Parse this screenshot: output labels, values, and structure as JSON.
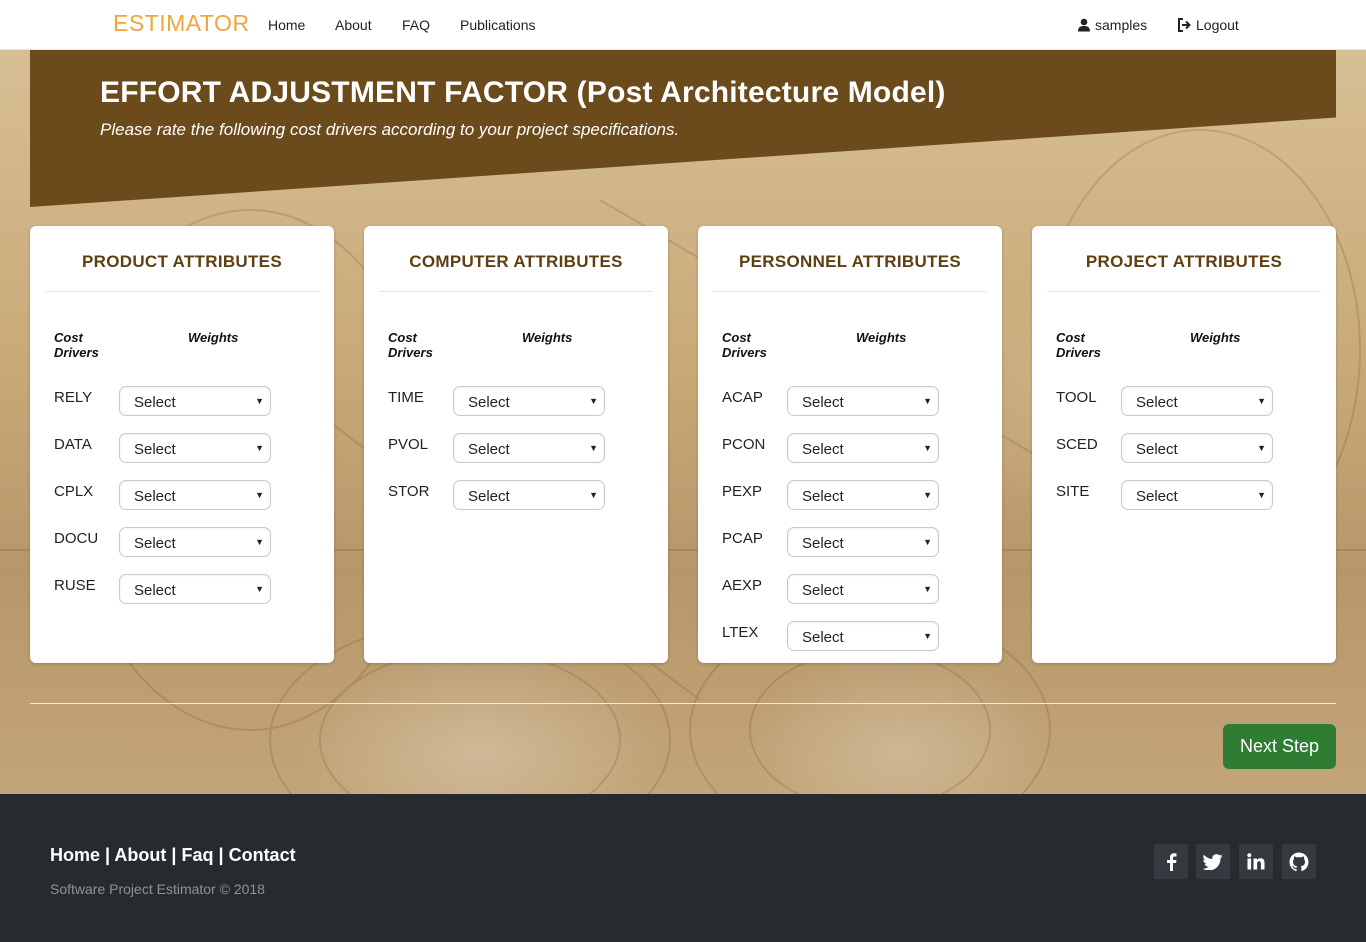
{
  "nav": {
    "brand": "ESTIMATOR",
    "links": [
      "Home",
      "About",
      "FAQ",
      "Publications"
    ],
    "user": "samples",
    "logout": "Logout"
  },
  "banner": {
    "title": "EFFORT ADJUSTMENT FACTOR (Post Architecture Model)",
    "subtitle": "Please rate the following cost drivers according to your project specifications."
  },
  "columns": {
    "drivers_line1": "Cost",
    "drivers_line2": "Drivers",
    "weights": "Weights"
  },
  "cards": [
    {
      "title": "PRODUCT ATTRIBUTES",
      "drivers": [
        "RELY",
        "DATA",
        "CPLX",
        "DOCU",
        "RUSE"
      ]
    },
    {
      "title": "COMPUTER ATTRIBUTES",
      "drivers": [
        "TIME",
        "PVOL",
        "STOR"
      ]
    },
    {
      "title": "PERSONNEL ATTRIBUTES",
      "drivers": [
        "ACAP",
        "PCON",
        "PEXP",
        "PCAP",
        "AEXP",
        "LTEX"
      ]
    },
    {
      "title": "PROJECT ATTRIBUTES",
      "drivers": [
        "TOOL",
        "SCED",
        "SITE"
      ]
    }
  ],
  "select_value": "Select",
  "next_button": "Next Step",
  "footer": {
    "links": [
      "Home",
      "About",
      "Faq",
      "Contact"
    ],
    "separator": "|",
    "copyright": "Software Project Estimator © 2018",
    "social": [
      "facebook-icon",
      "twitter-icon",
      "linkedin-icon",
      "github-icon"
    ]
  },
  "colors": {
    "brand": "#f0a53e",
    "banner": "#6b4a1c",
    "card_title": "#5e3f12",
    "next_button": "#2e7d32",
    "footer_bg": "#272b30"
  }
}
